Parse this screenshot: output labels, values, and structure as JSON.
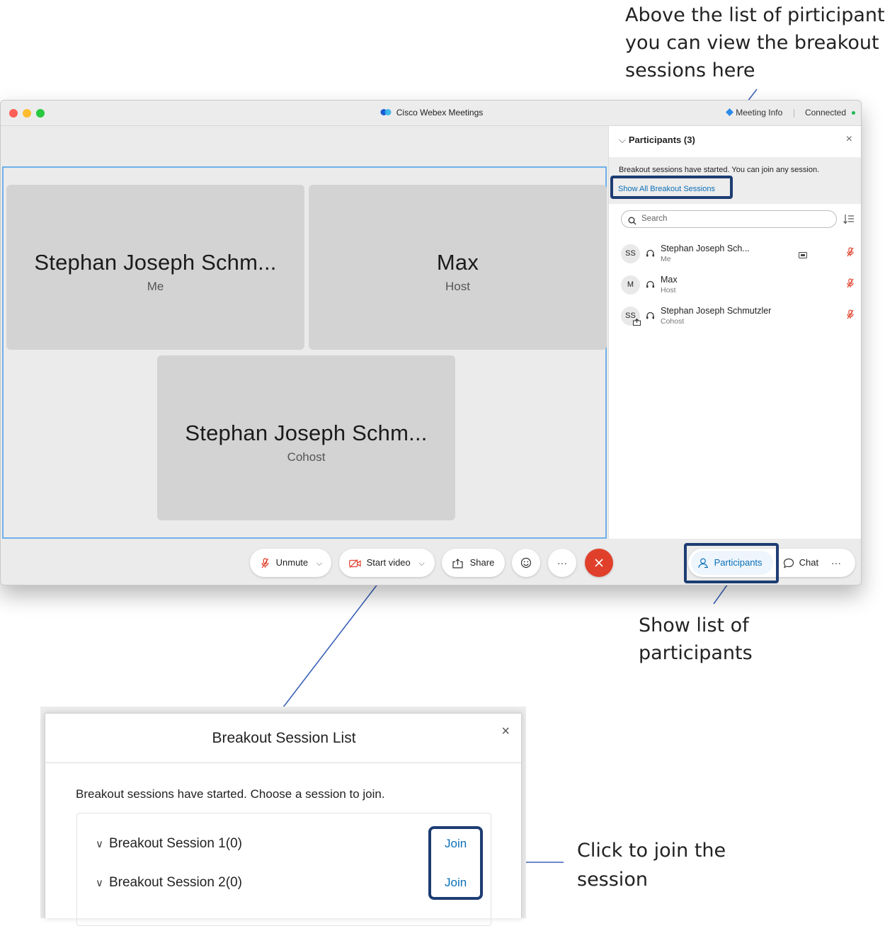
{
  "annotations": {
    "top_lines": [
      "Above the list of pirticipants",
      "you can view the breakout",
      "sessions here"
    ],
    "participants_lines": [
      "Show list of",
      "participants"
    ],
    "join_lines": [
      "Click to join the",
      "session"
    ]
  },
  "window": {
    "title": "Cisco Webex Meetings",
    "meeting_info": "Meeting Info",
    "status": "Connected"
  },
  "tiles": [
    {
      "name": "Stephan Joseph Schm...",
      "role": "Me"
    },
    {
      "name": "Max",
      "role": "Host"
    },
    {
      "name": "Stephan Joseph Schm...",
      "role": "Cohost"
    }
  ],
  "panel": {
    "title": "Participants (3)",
    "banner": "Breakout sessions have started. You can join any session.",
    "show_all": "Show All Breakout Sessions",
    "search_placeholder": "Search",
    "participants": [
      {
        "initials": "SS",
        "name": "Stephan Joseph Sch...",
        "role": "Me"
      },
      {
        "initials": "M",
        "name": "Max",
        "role": "Host"
      },
      {
        "initials": "SS",
        "name": "Stephan Joseph Schmutzler",
        "role": "Cohost"
      }
    ]
  },
  "controls": {
    "unmute": "Unmute",
    "start_video": "Start video",
    "share": "Share",
    "more": "···",
    "participants": "Participants",
    "chat": "Chat"
  },
  "dialog": {
    "title": "Breakout Session List",
    "message": "Breakout sessions have started. Choose a session to join.",
    "sessions": [
      {
        "name": "Breakout Session 1(0)",
        "action": "Join"
      },
      {
        "name": "Breakout Session 2(0)",
        "action": "Join"
      }
    ]
  },
  "colors": {
    "accent_blue": "#0a6fb6",
    "highlight": "#1d3d73",
    "end_call": "#e0402b",
    "mute_red": "#e0402b"
  }
}
